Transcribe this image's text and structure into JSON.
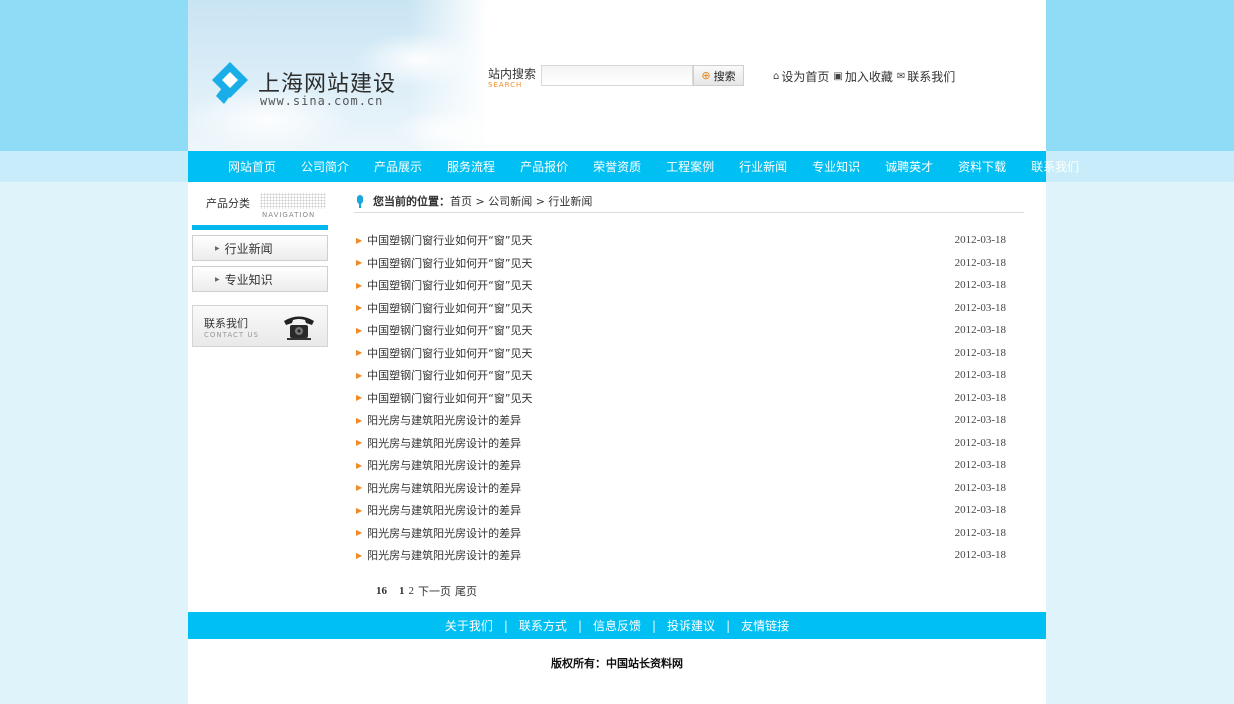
{
  "header": {
    "logo_title": "上海网站建设",
    "logo_url": "www.sina.com.cn",
    "search_label": "站内搜索",
    "search_label_en": "SEARCH",
    "search_placeholder": "",
    "search_button": "搜索",
    "links": [
      {
        "label": "设为首页",
        "icon": "home-icon"
      },
      {
        "label": "加入收藏",
        "icon": "bookmark-icon"
      },
      {
        "label": "联系我们",
        "icon": "contact-icon"
      }
    ]
  },
  "nav": {
    "items": [
      "网站首页",
      "公司简介",
      "产品展示",
      "服务流程",
      "产品报价",
      "荣誉资质",
      "工程案例",
      "行业新闻",
      "专业知识",
      "诚聘英才",
      "资料下载",
      "联系我们"
    ]
  },
  "sidebar": {
    "heading": "产品分类",
    "heading_en": "NAVIGATION",
    "items": [
      "行业新闻",
      "专业知识"
    ],
    "contact_label": "联系我们",
    "contact_en": "CONTACT US"
  },
  "breadcrumb": {
    "label": "您当前的位置：",
    "path": "首页 > 公司新闻 > 行业新闻"
  },
  "news": [
    {
      "title": "中国塑钢门窗行业如何开“窗”见天",
      "date": "2012-03-18"
    },
    {
      "title": "中国塑钢门窗行业如何开“窗”见天",
      "date": "2012-03-18"
    },
    {
      "title": "中国塑钢门窗行业如何开“窗”见天",
      "date": "2012-03-18"
    },
    {
      "title": "中国塑钢门窗行业如何开“窗”见天",
      "date": "2012-03-18"
    },
    {
      "title": "中国塑钢门窗行业如何开“窗”见天",
      "date": "2012-03-18"
    },
    {
      "title": "中国塑钢门窗行业如何开“窗”见天",
      "date": "2012-03-18"
    },
    {
      "title": "中国塑钢门窗行业如何开“窗”见天",
      "date": "2012-03-18"
    },
    {
      "title": "中国塑钢门窗行业如何开“窗”见天",
      "date": "2012-03-18"
    },
    {
      "title": "阳光房与建筑阳光房设计的差异",
      "date": "2012-03-18"
    },
    {
      "title": "阳光房与建筑阳光房设计的差异",
      "date": "2012-03-18"
    },
    {
      "title": "阳光房与建筑阳光房设计的差异",
      "date": "2012-03-18"
    },
    {
      "title": "阳光房与建筑阳光房设计的差异",
      "date": "2012-03-18"
    },
    {
      "title": "阳光房与建筑阳光房设计的差异",
      "date": "2012-03-18"
    },
    {
      "title": "阳光房与建筑阳光房设计的差异",
      "date": "2012-03-18"
    },
    {
      "title": "阳光房与建筑阳光房设计的差异",
      "date": "2012-03-18"
    }
  ],
  "pager": {
    "total": "16",
    "current": "1",
    "page2": "2",
    "next": "下一页",
    "last": "尾页"
  },
  "footer": {
    "links": [
      "关于我们",
      "联系方式",
      "信息反馈",
      "投诉建议",
      "友情链接"
    ],
    "separator": "|",
    "copyright": "版权所有：中国站长资料网"
  },
  "colors": {
    "accent": "#00c0f3",
    "bullet": "#f08a24",
    "bg_top": "#8fdcf6",
    "bg_bottom": "#dff3fb"
  }
}
